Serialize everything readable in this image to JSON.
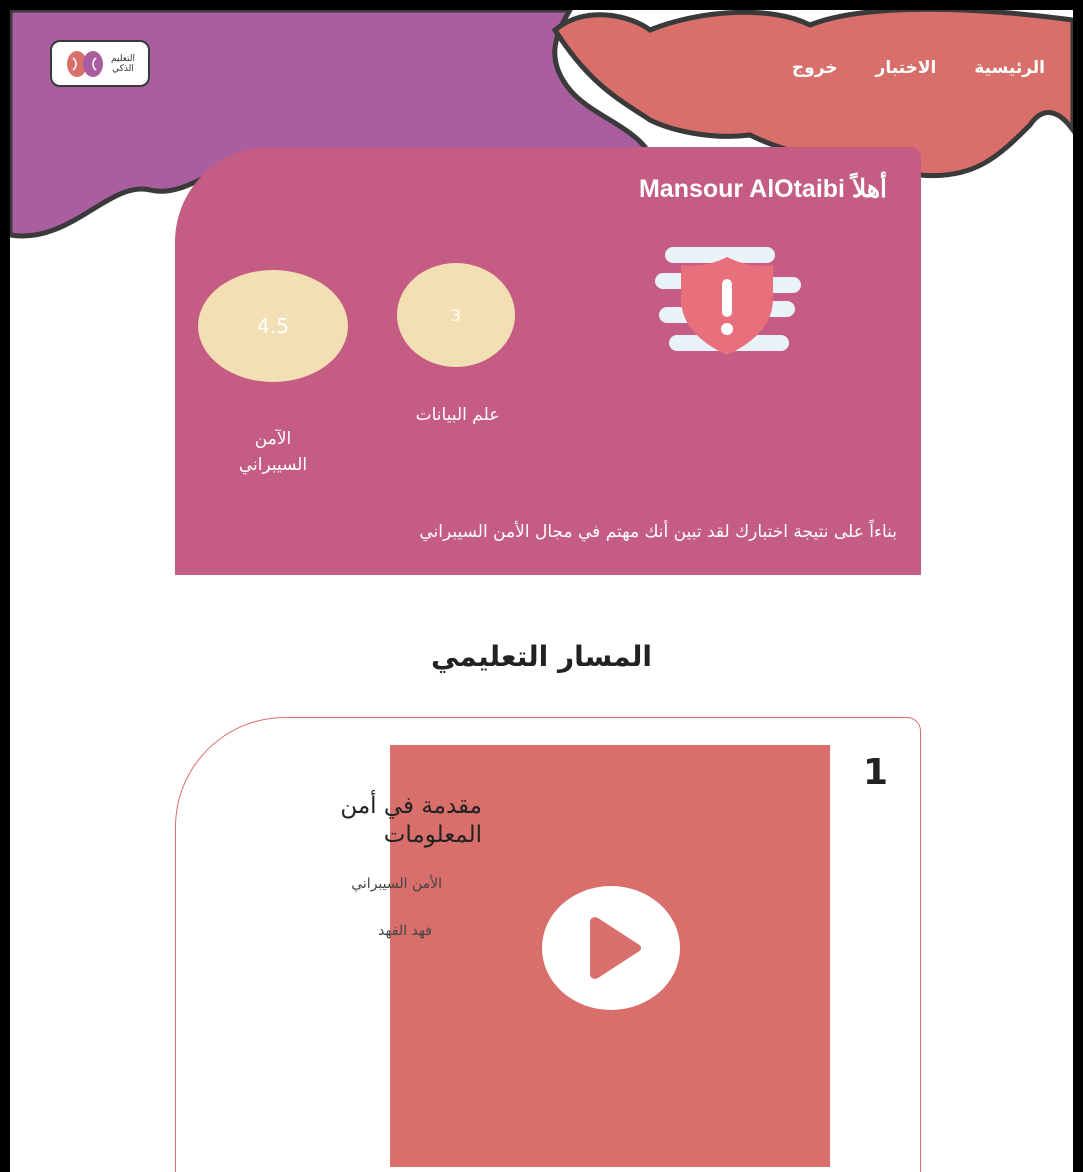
{
  "nav": {
    "items": [
      {
        "label": "الرئيسية"
      },
      {
        "label": "الاختبار"
      },
      {
        "label": "خروج"
      }
    ]
  },
  "logo": {
    "line1": "التعليم",
    "line2": "الذكي"
  },
  "hero": {
    "greeting": "أهلاً Mansour AlOtaibi",
    "scores": [
      {
        "value": "4.5",
        "label": "الآمن السيبراني"
      },
      {
        "value": "3",
        "label": "علم البيانات"
      }
    ],
    "note": "بناءاً على نتيجة اختبارك لقد تبين أنك مهتم في مجال الأمن السيبراني"
  },
  "section": {
    "title": "المسار التعليمي"
  },
  "course": {
    "number": "1",
    "title": "مقدمة في أمن المعلومات",
    "field": "الأمن السيبراني",
    "teacher": "فهد الفهد"
  },
  "colors": {
    "purple": "#a95f9f",
    "coral": "#d86f6a",
    "pink": "#c55c83",
    "cream": "#f2dfb4"
  },
  "icons": [
    "brain-logo-icon",
    "shield-warning-icon",
    "play-icon"
  ]
}
